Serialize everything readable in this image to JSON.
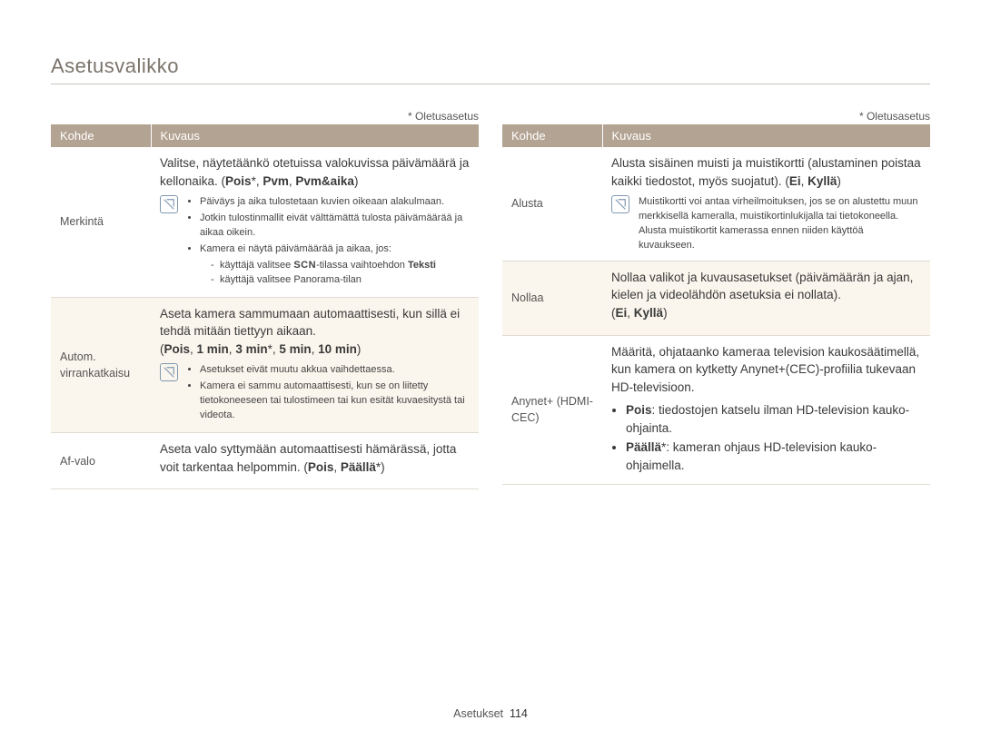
{
  "pageTitle": "Asetusvalikko",
  "defaultNote": "* Oletusasetus",
  "header": {
    "kohde": "Kohde",
    "kuvaus": "Kuvaus"
  },
  "left": {
    "merkinta": {
      "label": "Merkintä",
      "desc1": "Valitse, näytetäänkö otetuissa valokuvissa päivämäärä ja kellonaika. (",
      "opt1": "Pois",
      "sep": ", ",
      "opt2": "Pvm",
      "opt3": "Pvm&aika",
      "close": ")",
      "note1": "Päiväys ja aika tulostetaan kuvien oikeaan alakulmaan.",
      "note2": "Jotkin tulostinmallit eivät välttämättä tulosta päivämäärää ja aikaa oikein.",
      "note3": "Kamera ei näytä päivämäärää ja aikaa, jos:",
      "note3a_pre": "käyttäjä valitsee ",
      "note3a_scn": "SCN",
      "note3a_post": "-tilassa vaihtoehdon ",
      "note3a_bold": "Teksti",
      "note3b": "käyttäjä valitsee Panorama-tilan"
    },
    "autom": {
      "label": "Autom. virrankatkaisu",
      "desc": "Aseta kamera sammumaan automaattisesti, kun sillä ei tehdä mitään tiettyyn aikaan.",
      "opts_open": "(",
      "o1": "Pois",
      "o2": "1 min",
      "o3": "3 min",
      "o4": "5 min",
      "o5": "10 min",
      "opts_close": ")",
      "star": "*",
      "note1": "Asetukset eivät muutu akkua vaihdettaessa.",
      "note2": "Kamera ei sammu automaattisesti, kun se on liitetty tietokoneeseen tai tulostimeen tai kun esität kuvaesitystä tai videota."
    },
    "afvalo": {
      "label": "Af-valo",
      "desc_a": "Aseta valo syttymään automaattisesti hämärässä, jotta voit tarkentaa helpommin. (",
      "o1": "Pois",
      "o2": "Päällä",
      "star": "*",
      "close": ")"
    }
  },
  "right": {
    "alusta": {
      "label": "Alusta",
      "desc_a": "Alusta sisäinen muisti ja muistikortti (alustaminen poistaa kaikki tiedostot, myös suojatut). (",
      "o1": "Ei",
      "o2": "Kyllä",
      "close": ")",
      "note": "Muistikortti voi antaa virheilmoituksen, jos se on alustettu muun merkkisellä kameralla, muistikortinlukijalla tai tietokoneella. Alusta muistikortit kamerassa ennen niiden käyttöä kuvaukseen."
    },
    "nollaa": {
      "label": "Nollaa",
      "desc": "Nollaa valikot ja kuvausasetukset (päivämäärän ja ajan, kielen ja videolähdön asetuksia ei nollata).",
      "opts_open": "(",
      "o1": "Ei",
      "o2": "Kyllä",
      "close": ")"
    },
    "anynet": {
      "label": "Anynet+ (HDMI-CEC)",
      "desc": "Määritä, ohjataanko kameraa television kaukosäätimellä, kun kamera on kytketty Anynet+(CEC)-profiilia tukevaan HD-televisioon.",
      "b1_label": "Pois",
      "b1_text": ": tiedostojen katselu ilman HD-television kauko-ohjainta.",
      "b2_label": "Päällä",
      "b2_star": "*",
      "b2_text": ": kameran ohjaus HD-television kauko-ohjaimella."
    }
  },
  "footer": {
    "section": "Asetukset",
    "page": "114"
  }
}
